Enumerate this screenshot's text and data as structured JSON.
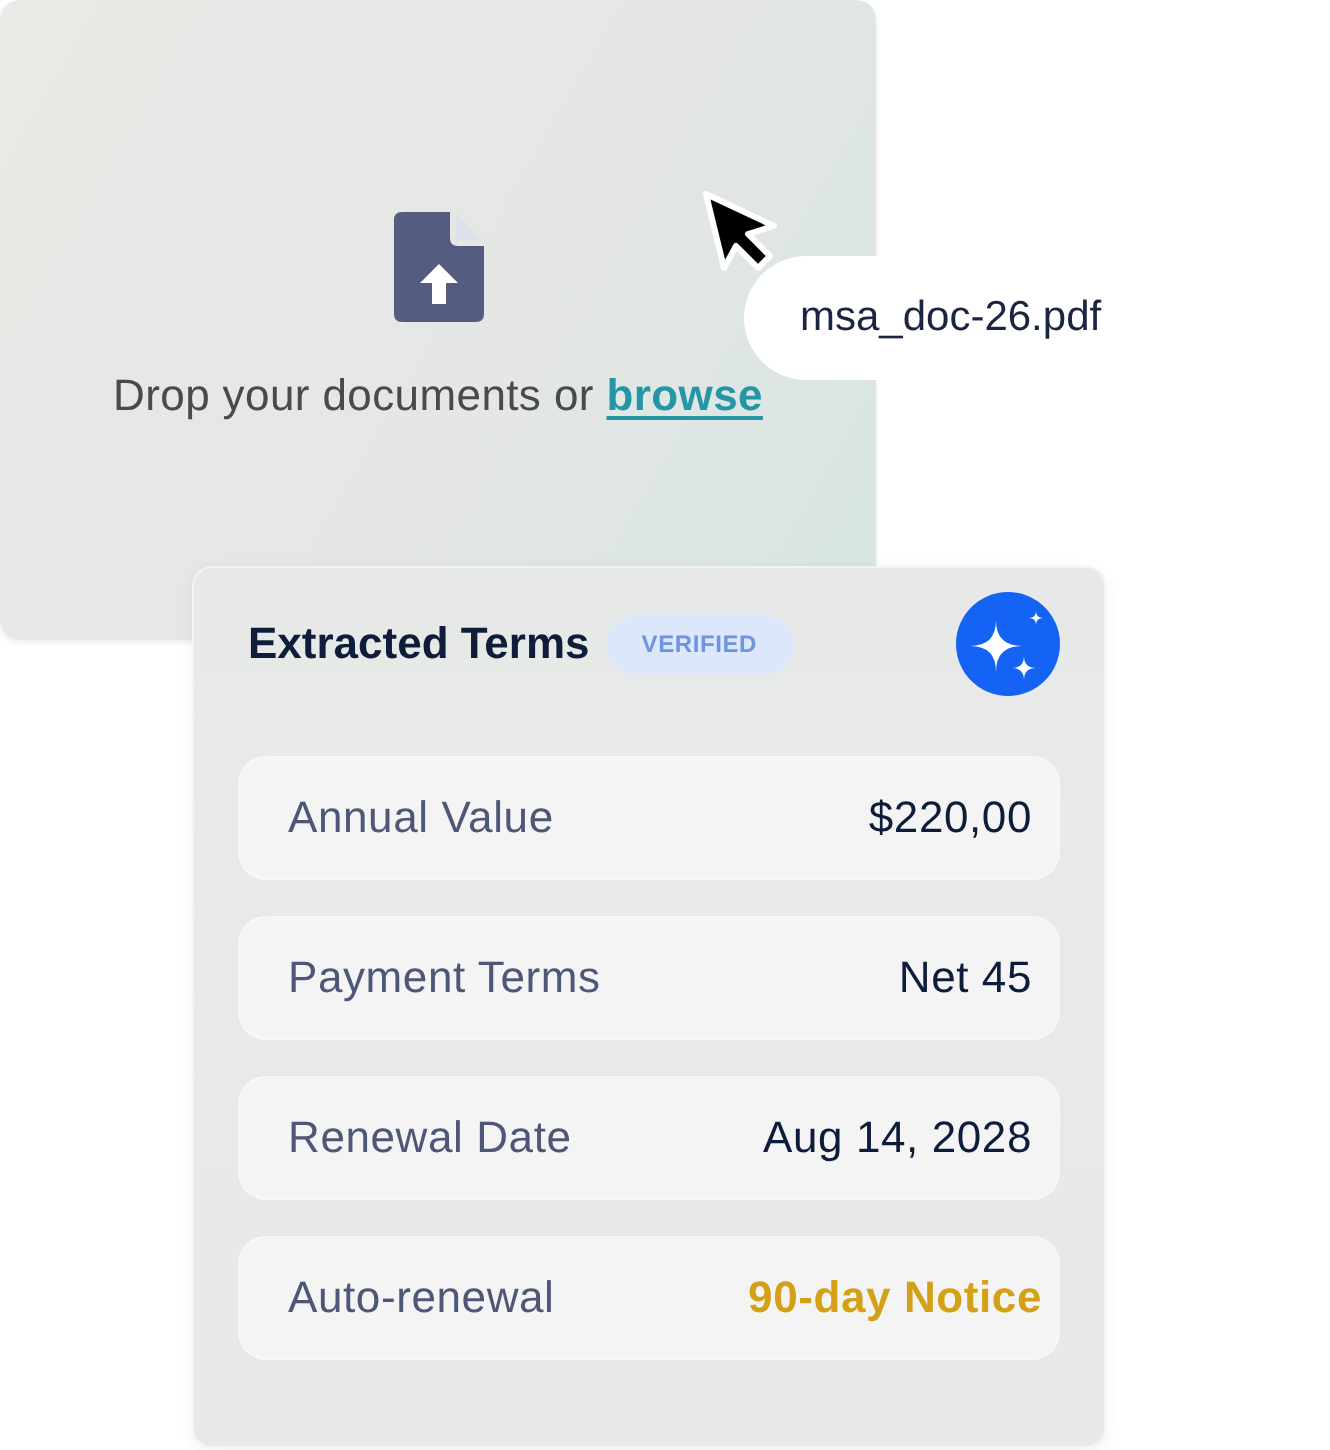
{
  "upload": {
    "prompt": "Drop your documents or",
    "link": "browse"
  },
  "dragged_file": {
    "name": "msa_doc-26.pdf"
  },
  "terms_card": {
    "title": "Extracted Terms",
    "badge": "VERIFIED",
    "fields": [
      {
        "label": "Annual Value",
        "value": "$220,00",
        "kind": "plain"
      },
      {
        "label": "Payment Terms",
        "value": "Net 45",
        "kind": "plain"
      },
      {
        "label": "Renewal Date",
        "value": "Aug 14, 2028",
        "kind": "plain"
      },
      {
        "label": "Auto-renewal",
        "value": "90-day Notice",
        "kind": "highlight"
      }
    ]
  }
}
